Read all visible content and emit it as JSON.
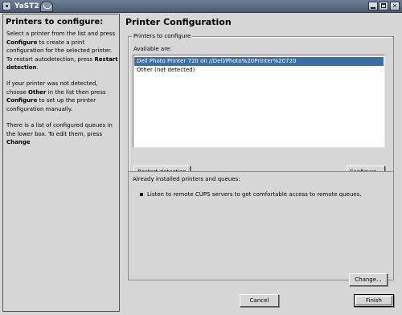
{
  "window": {
    "title": "YaST2"
  },
  "help": {
    "title": "Printers to configure:",
    "p1": {
      "t1": "Select a printer from the list and press ",
      "b1": "Configure",
      "t2": " to create a print configuration for the selected printer. To restart autodetection, press ",
      "b2": "Restart detection",
      "t3": "."
    },
    "p2": {
      "t1": "If your printer was not detected, choose ",
      "b1": "Other",
      "t2": " in the list then press ",
      "b2": "Configure",
      "t3": " to set up the printer configuration manually."
    },
    "p3": {
      "t1": "There is a list of configured queues in the lower box. To edit them, press ",
      "b1": "Change"
    }
  },
  "main": {
    "title": "Printer Configuration",
    "group_label": "Printers to configure",
    "available_label": "Available are:",
    "printers": [
      "Dell Photo Printer 720 on //Dell/Photo%20Printer%20720",
      "Other (not detected)"
    ],
    "restart_button": "Restart detection",
    "configure_button": "Configure...",
    "installed_heading": "Already installed printers and queues:",
    "installed_items": [
      "Listen to remote CUPS servers to get comfortable access to remote queues."
    ],
    "change_button": "Change...",
    "cancel_button": "Cancel",
    "finish_button": "Finish"
  }
}
